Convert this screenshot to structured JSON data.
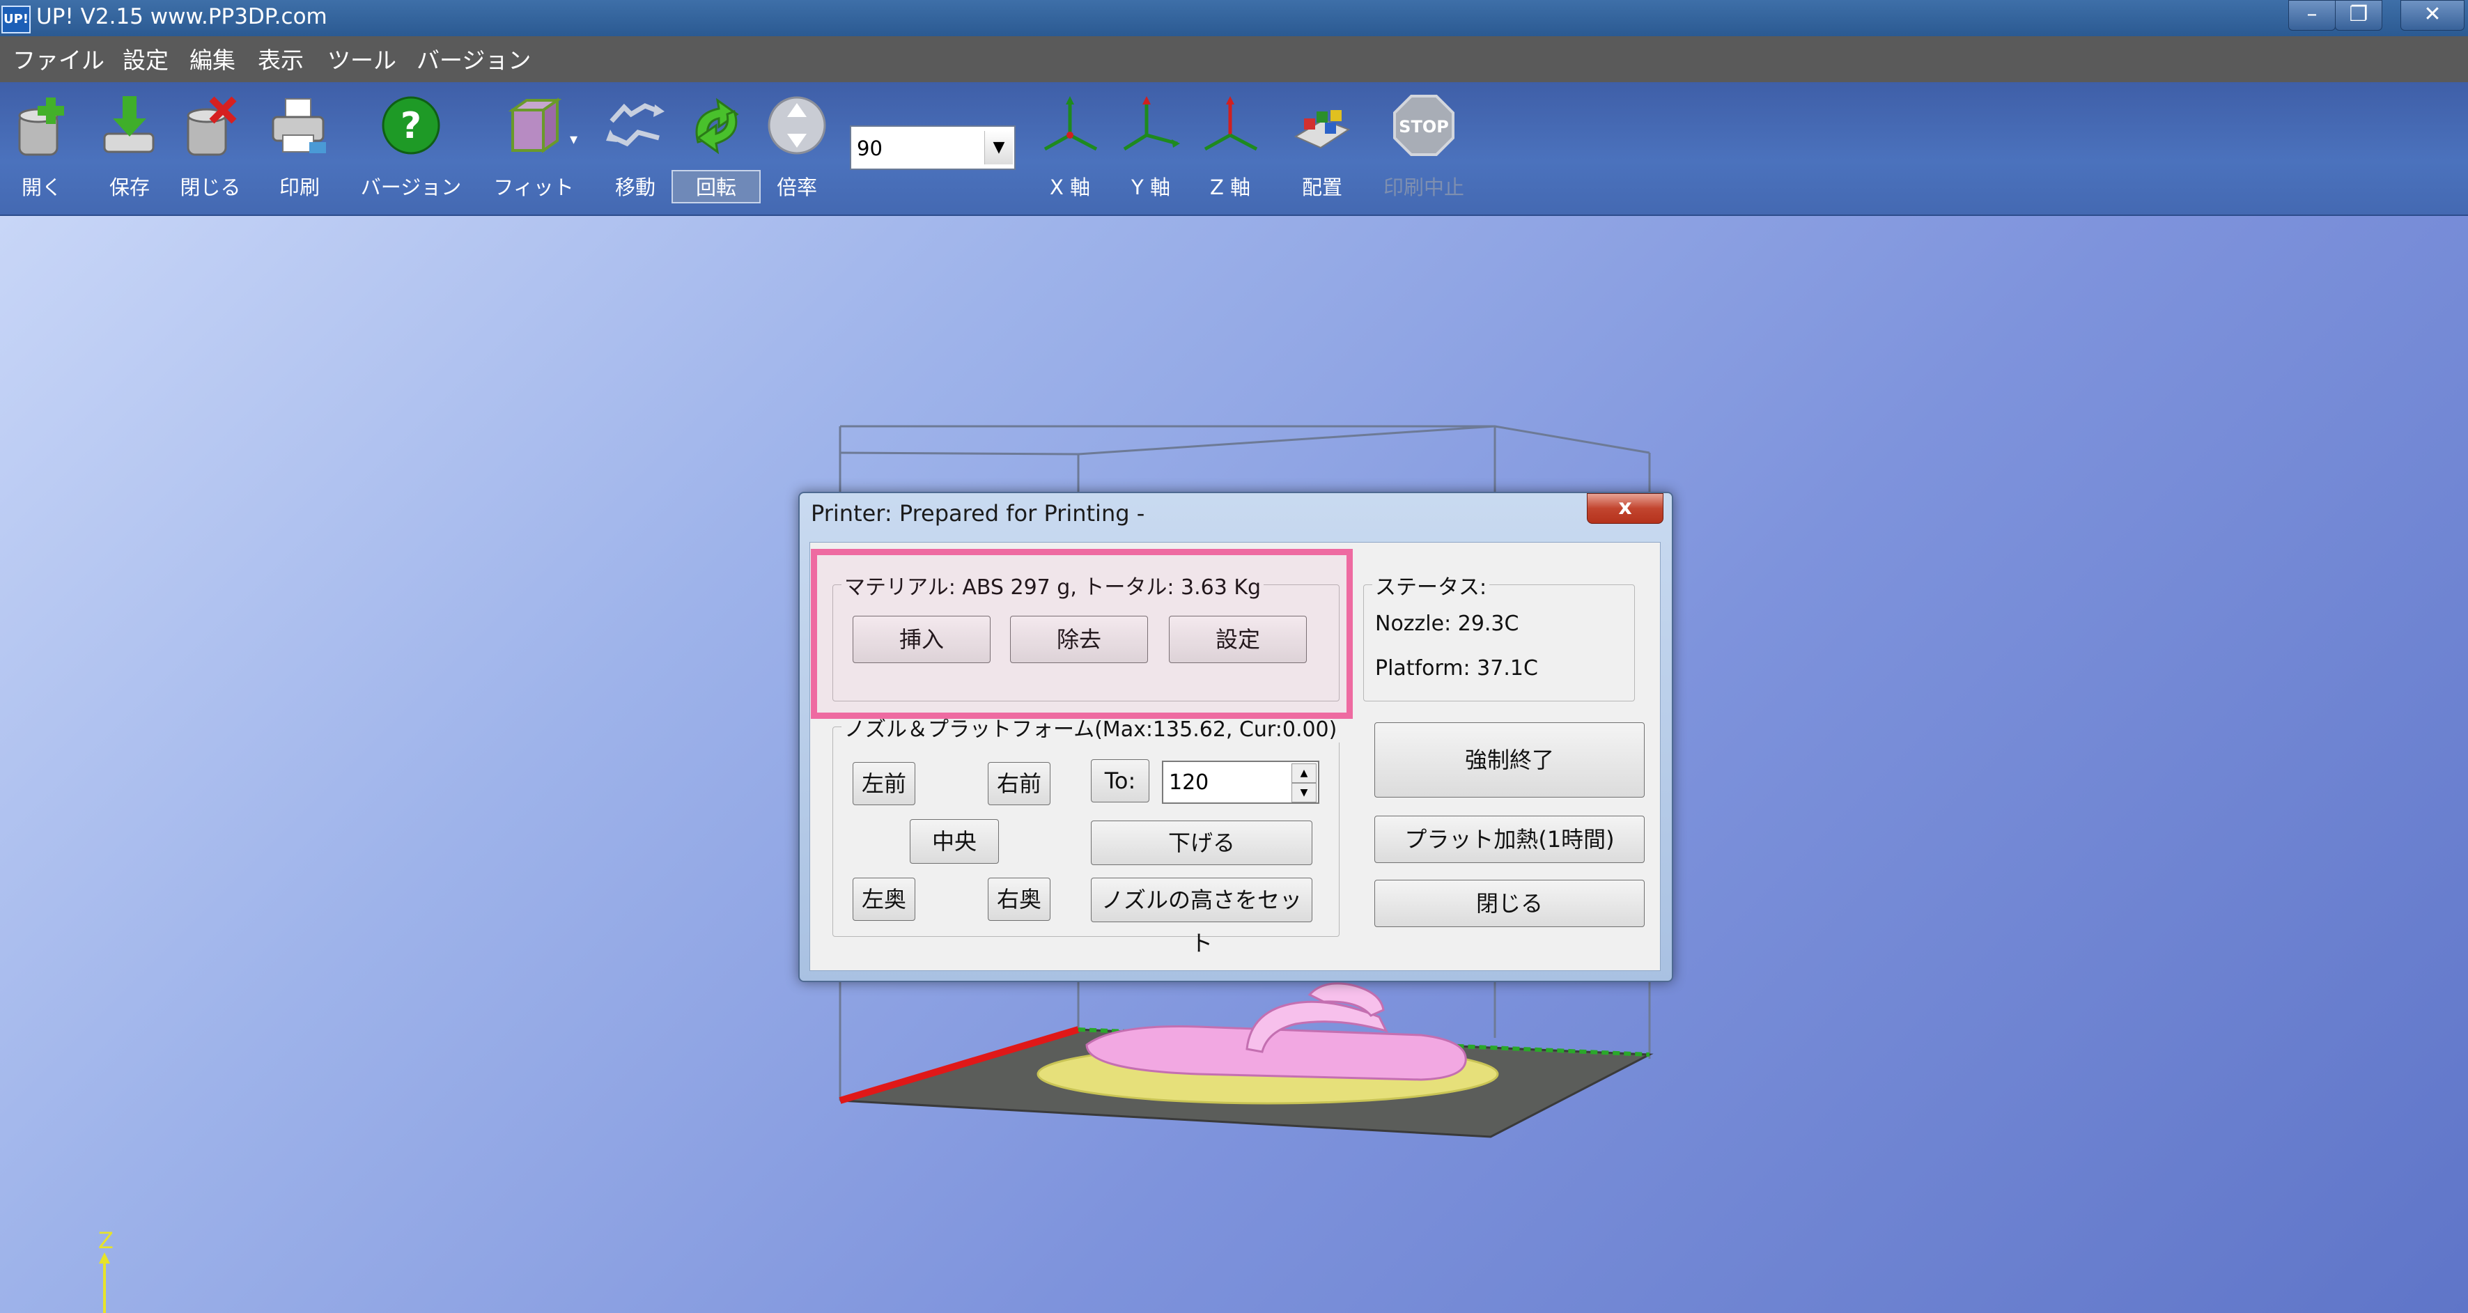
{
  "window": {
    "title": "UP!  V2.15 www.PP3DP.com",
    "app_icon_text": "UP!"
  },
  "menu": [
    "ファイル",
    "設定",
    "編集",
    "表示",
    "ツール",
    "バージョン"
  ],
  "toolbar": {
    "buttons": [
      {
        "label": "開く",
        "icon": "open-icon"
      },
      {
        "label": "保存",
        "icon": "save-icon"
      },
      {
        "label": "閉じる",
        "icon": "close-file-icon"
      },
      {
        "label": "印刷",
        "icon": "printer-icon"
      },
      {
        "label": "バージョン",
        "icon": "help-icon"
      },
      {
        "label": "フィット",
        "icon": "fit-cube-icon"
      },
      {
        "label": "移動",
        "icon": "move-icon"
      },
      {
        "label": "回転",
        "icon": "rotate-icon"
      },
      {
        "label": "倍率",
        "icon": "scale-icon"
      },
      {
        "label": "X 軸",
        "icon": "x-axis-icon"
      },
      {
        "label": "Y 軸",
        "icon": "y-axis-icon"
      },
      {
        "label": "Z 軸",
        "icon": "z-axis-icon"
      },
      {
        "label": "配置",
        "icon": "arrange-icon"
      },
      {
        "label": "印刷中止",
        "icon": "stop-icon"
      }
    ],
    "stop_icon_text": "STOP",
    "zoom_value": "90"
  },
  "viewport": {
    "axis_label": "Z"
  },
  "dialog": {
    "title": "Printer: Prepared for Printing -",
    "close_label": "x",
    "material": {
      "legend": "マテリアル: ABS 297 g, トータル: 3.63 Kg",
      "insert": "挿入",
      "remove": "除去",
      "settings": "設定"
    },
    "nozzle": {
      "legend": "ノズル＆プラットフォーム(Max:135.62, Cur:0.00)",
      "front_left": "左前",
      "front_right": "右前",
      "center": "中央",
      "back_left": "左奥",
      "back_right": "右奥",
      "to_label": "To:",
      "to_value": "120",
      "lower": "下げる",
      "set_height": "ノズルの高さをセット"
    },
    "status": {
      "legend": "ステータス:",
      "nozzle": "Nozzle: 29.3C",
      "platform": "Platform: 37.1C"
    },
    "force_stop": "強制終了",
    "plate_heat": "プラット加熱(1時間)",
    "close": "閉じる"
  },
  "colors": {
    "highlight": "#ee6aa1",
    "toolbar": "#4b72bd",
    "menubar": "#5a5a5a"
  }
}
